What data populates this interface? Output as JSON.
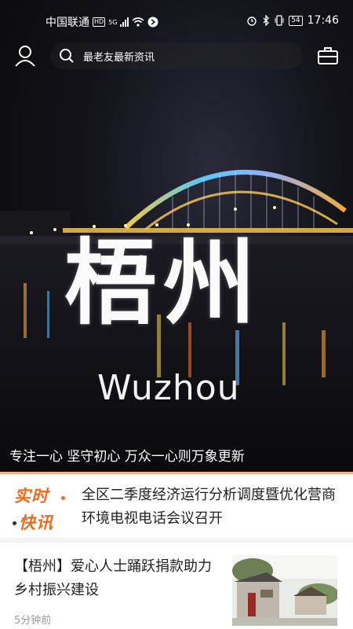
{
  "status_bar": {
    "carrier": "中国联通",
    "hd": "HD",
    "network": "5G",
    "battery": "54",
    "time": "17:46"
  },
  "search": {
    "placeholder": "最老友最新资讯"
  },
  "hero": {
    "city_name": "梧州",
    "city_name_en": "Wuzhou",
    "slogan": "专注一心 坚守初心 万众一心则万象更新"
  },
  "flash_news": {
    "logo_line1": "实时",
    "logo_line2": "快讯",
    "headline": "全区二季度经济运行分析调度暨优化营商环境电视电话会议召开"
  },
  "news": [
    {
      "title": "【梧州】爱心人士踊跃捐款助力乡村振兴建设",
      "time": "5分钟前"
    }
  ],
  "colors": {
    "accent_orange": "#ef6a1f",
    "flash_border": "#f4b083"
  }
}
